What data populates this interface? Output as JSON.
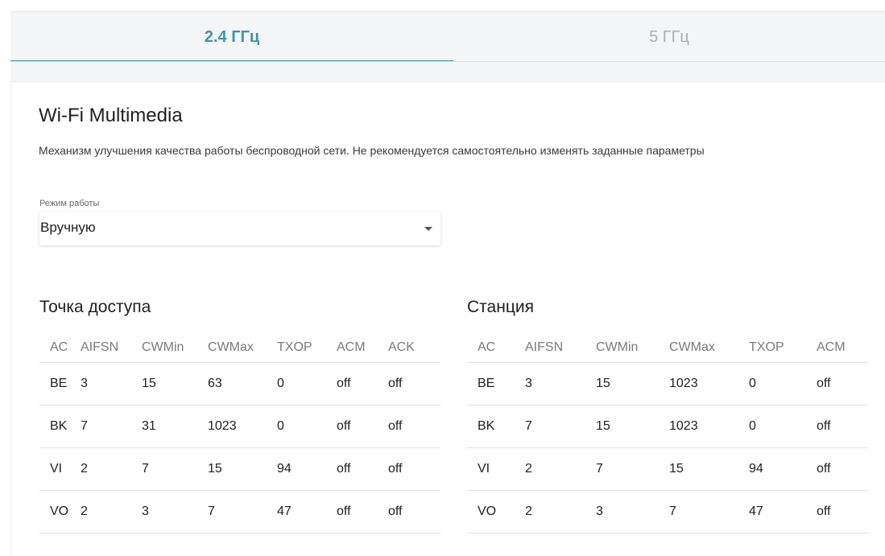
{
  "tabs": [
    {
      "label": "2.4 ГГц",
      "active": true
    },
    {
      "label": "5 ГГц",
      "active": false
    }
  ],
  "section": {
    "title": "Wi-Fi Multimedia",
    "description": "Механизм улучшения качества работы беспроводной сети. Не рекомендуется самостоятельно изменять заданные параметры"
  },
  "mode": {
    "label": "Режим работы",
    "value": "Вручную"
  },
  "access_point": {
    "title": "Точка доступа",
    "headers": [
      "AC",
      "AIFSN",
      "CWMin",
      "CWMax",
      "TXOP",
      "ACM",
      "ACK"
    ],
    "rows": [
      [
        "BE",
        "3",
        "15",
        "63",
        "0",
        "off",
        "off"
      ],
      [
        "BK",
        "7",
        "31",
        "1023",
        "0",
        "off",
        "off"
      ],
      [
        "VI",
        "2",
        "7",
        "15",
        "94",
        "off",
        "off"
      ],
      [
        "VO",
        "2",
        "3",
        "7",
        "47",
        "off",
        "off"
      ]
    ]
  },
  "station": {
    "title": "Станция",
    "headers": [
      "AC",
      "AIFSN",
      "CWMin",
      "CWMax",
      "TXOP",
      "ACM"
    ],
    "rows": [
      [
        "BE",
        "3",
        "15",
        "1023",
        "0",
        "off"
      ],
      [
        "BK",
        "7",
        "15",
        "1023",
        "0",
        "off"
      ],
      [
        "VI",
        "2",
        "7",
        "15",
        "94",
        "off"
      ],
      [
        "VO",
        "2",
        "3",
        "7",
        "47",
        "off"
      ]
    ]
  },
  "colors": {
    "accent": "#3d96a8",
    "inactive_tab": "#a8aeb2",
    "tab_background": "#f3f5f6"
  }
}
